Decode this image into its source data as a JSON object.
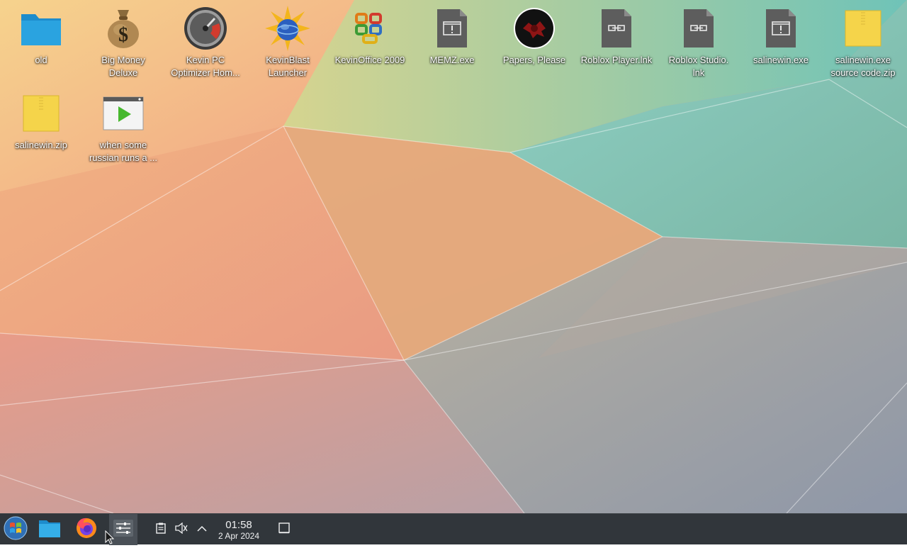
{
  "desktop": {
    "icons": [
      {
        "label": "old",
        "icon": "folder-icon"
      },
      {
        "label": "Big Money\nDeluxe",
        "icon": "money-bag-icon"
      },
      {
        "label": "Kevin PC\nOptimizer Hom...",
        "icon": "speedometer-icon"
      },
      {
        "label": "KevinBlast\nLauncher",
        "icon": "starburst-globe-icon"
      },
      {
        "label": "KevinOffice 2009",
        "icon": "office-logo-icon"
      },
      {
        "label": "MEMZ.exe",
        "icon": "executable-file-icon"
      },
      {
        "label": "Papers, Please",
        "icon": "papers-please-emblem-icon"
      },
      {
        "label": "Roblox Player.lnk",
        "icon": "shortcut-file-icon"
      },
      {
        "label": "Roblox Studio.\nlnk",
        "icon": "shortcut-file-icon"
      },
      {
        "label": "salinewin.exe",
        "icon": "executable-file-icon"
      },
      {
        "label": "salinewin.exe\nsource code.zip",
        "icon": "zip-archive-icon"
      },
      {
        "label": "salinewin.zip",
        "icon": "zip-archive-icon"
      },
      {
        "label": "when some\nrussian runs a ...",
        "icon": "video-file-icon"
      }
    ]
  },
  "taskbar": {
    "start_icon": "start-orb-icon",
    "pinned": [
      {
        "icon": "file-manager-icon"
      },
      {
        "icon": "firefox-icon"
      },
      {
        "icon": "mixer-settings-icon"
      }
    ],
    "tray": [
      {
        "icon": "clipboard-icon"
      },
      {
        "icon": "volume-muted-icon"
      },
      {
        "icon": "chevron-up-icon"
      }
    ],
    "clock": {
      "time": "01:58",
      "date": "2 Apr 2024"
    },
    "show_desktop_icon": "show-desktop-icon"
  },
  "colors": {
    "taskbar_bg": "#31363b",
    "folder_blue": "#2a9fd8",
    "zip_yellow": "#f5d44a",
    "file_gray": "#5b5b5b"
  }
}
